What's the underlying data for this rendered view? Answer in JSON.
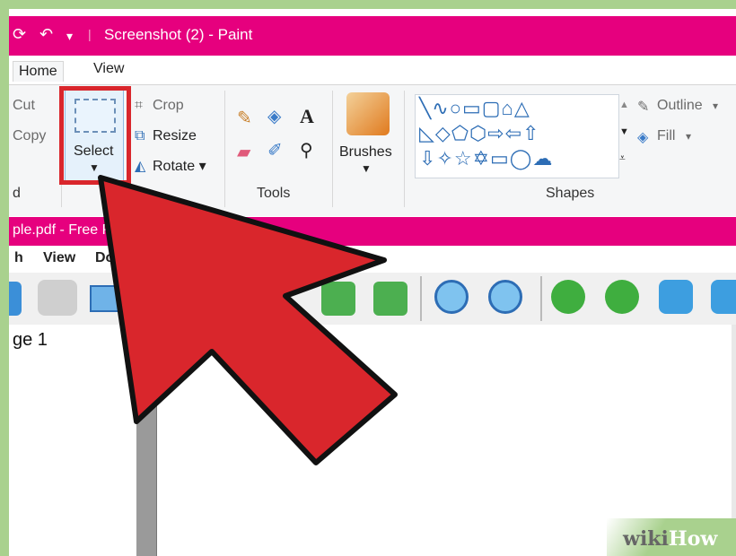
{
  "paint": {
    "title": "Screenshot (2) - Paint",
    "tabs": [
      "Home",
      "View"
    ],
    "clipboard": {
      "cut": "Cut",
      "copy": "Copy",
      "group_label_fragment": "d"
    },
    "image": {
      "select": "Select",
      "crop": "Crop",
      "resize": "Resize",
      "rotate": "Rotate ▾"
    },
    "tools_label": "Tools",
    "brushes_label": "Brushes",
    "shapes_label": "Shapes",
    "outline_label": "Outline",
    "fill_label": "Fill"
  },
  "pdf": {
    "title_fragment": "ple.pdf - Free P",
    "menu": [
      "h",
      "View",
      "Docu"
    ],
    "page_label": "ge 1"
  },
  "watermark": {
    "wiki": "wiki",
    "how": "How"
  },
  "colors": {
    "titlebar": "#e6007e",
    "highlight": "#d9262c",
    "arrow": "#d9262c"
  }
}
